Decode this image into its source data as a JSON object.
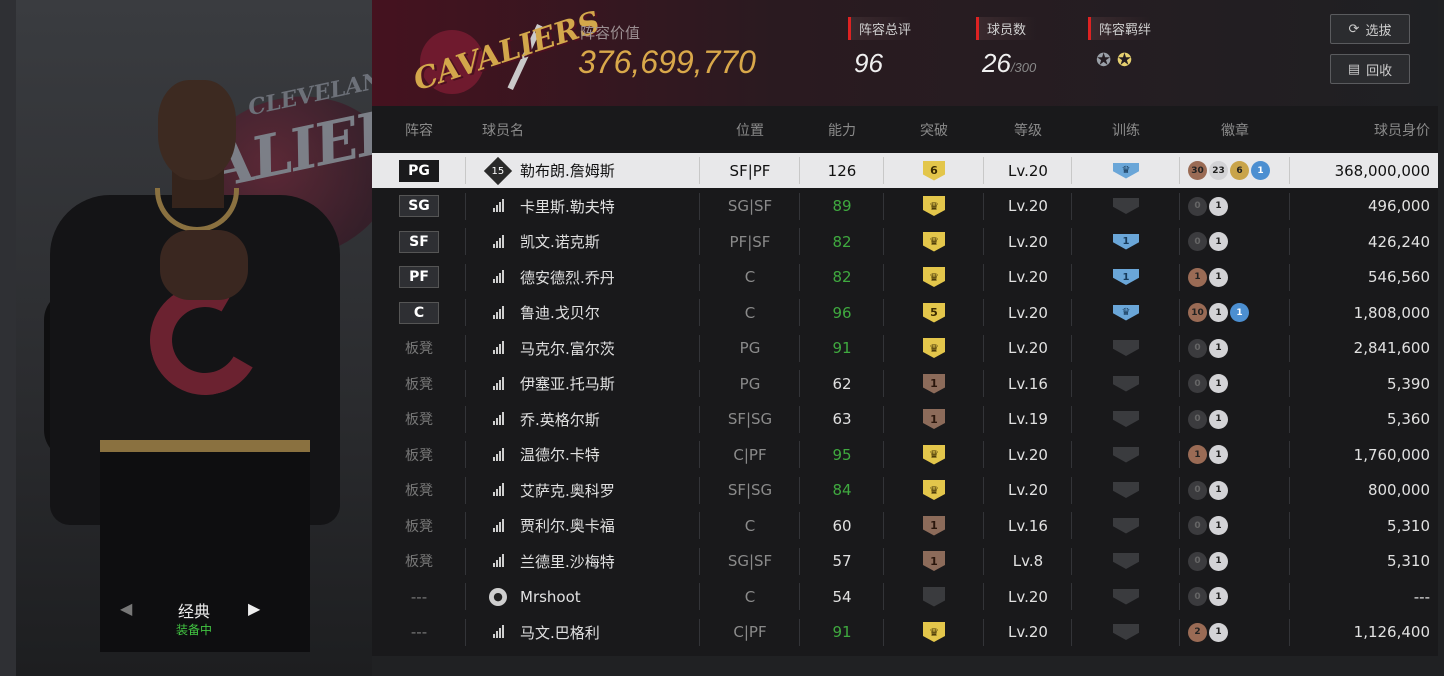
{
  "left": {
    "style_name": "经典",
    "style_status": "装备中"
  },
  "header": {
    "team_logo_text": "CAVALIERS",
    "value_label": "阵容价值",
    "value": "376,699,770",
    "rating_label": "阵容总评",
    "rating": "96",
    "players_label": "球员数",
    "players_count": "26",
    "players_max": "/300",
    "bond_label": "阵容羁绊",
    "select_btn": "选拔",
    "recycle_btn": "回收"
  },
  "columns": [
    "阵容",
    "球员名",
    "位置",
    "能力",
    "突破",
    "等级",
    "训练",
    "徽章",
    "球员身价"
  ],
  "rows": [
    {
      "slot": "PG",
      "slot_type": "pos",
      "icon": "star-15",
      "num": "15",
      "name": "勒布朗.詹姆斯",
      "pos": "SF|PF",
      "ability": "126",
      "ability_color": "white",
      "break": "6",
      "break_type": "gold",
      "level": "Lv.20",
      "train": "blue-crown",
      "badges": [
        [
          "bronze",
          "30"
        ],
        [
          "silver",
          "23"
        ],
        [
          "gold",
          "6"
        ],
        [
          "blue",
          "1"
        ]
      ],
      "price": "368,000,000",
      "selected": true
    },
    {
      "slot": "SG",
      "slot_type": "pos",
      "icon": "signal",
      "name": "卡里斯.勒夫特",
      "pos": "SG|SF",
      "ability": "89",
      "ability_color": "green",
      "break": "♛",
      "break_type": "gold",
      "level": "Lv.20",
      "train": "gray",
      "badges": [
        [
          "dark",
          "0"
        ],
        [
          "silver",
          "1"
        ]
      ],
      "price": "496,000"
    },
    {
      "slot": "SF",
      "slot_type": "pos",
      "icon": "signal",
      "name": "凯文.诺克斯",
      "pos": "PF|SF",
      "ability": "82",
      "ability_color": "green",
      "break": "♛",
      "break_type": "gold",
      "level": "Lv.20",
      "train": "blue-1",
      "badges": [
        [
          "dark",
          "0"
        ],
        [
          "silver",
          "1"
        ]
      ],
      "price": "426,240"
    },
    {
      "slot": "PF",
      "slot_type": "pos",
      "icon": "signal",
      "name": "德安德烈.乔丹",
      "pos": "C",
      "ability": "82",
      "ability_color": "green",
      "break": "♛",
      "break_type": "gold",
      "level": "Lv.20",
      "train": "blue-1",
      "badges": [
        [
          "bronze",
          "1"
        ],
        [
          "silver",
          "1"
        ]
      ],
      "price": "546,560"
    },
    {
      "slot": "C",
      "slot_type": "pos",
      "icon": "signal",
      "name": "鲁迪.戈贝尔",
      "pos": "C",
      "ability": "96",
      "ability_color": "green",
      "break": "5",
      "break_type": "gold",
      "level": "Lv.20",
      "train": "blue-crown",
      "badges": [
        [
          "bronze",
          "10"
        ],
        [
          "silver",
          "1"
        ],
        [
          "blue",
          "1"
        ]
      ],
      "price": "1,808,000"
    },
    {
      "slot": "板凳",
      "slot_type": "bench",
      "icon": "signal",
      "name": "马克尔.富尔茨",
      "pos": "PG",
      "ability": "91",
      "ability_color": "green",
      "break": "♛",
      "break_type": "gold",
      "level": "Lv.20",
      "train": "gray",
      "badges": [
        [
          "dark",
          "0"
        ],
        [
          "silver",
          "1"
        ]
      ],
      "price": "2,841,600"
    },
    {
      "slot": "板凳",
      "slot_type": "bench",
      "icon": "signal",
      "name": "伊塞亚.托马斯",
      "pos": "PG",
      "ability": "62",
      "ability_color": "white",
      "break": "1",
      "break_type": "brown",
      "level": "Lv.16",
      "train": "gray",
      "badges": [
        [
          "dark",
          "0"
        ],
        [
          "silver",
          "1"
        ]
      ],
      "price": "5,390"
    },
    {
      "slot": "板凳",
      "slot_type": "bench",
      "icon": "signal",
      "name": "乔.英格尔斯",
      "pos": "SF|SG",
      "ability": "63",
      "ability_color": "white",
      "break": "1",
      "break_type": "brown",
      "level": "Lv.19",
      "train": "gray",
      "badges": [
        [
          "dark",
          "0"
        ],
        [
          "silver",
          "1"
        ]
      ],
      "price": "5,360"
    },
    {
      "slot": "板凳",
      "slot_type": "bench",
      "icon": "signal",
      "name": "温德尔.卡特",
      "pos": "C|PF",
      "ability": "95",
      "ability_color": "green",
      "break": "♛",
      "break_type": "gold",
      "level": "Lv.20",
      "train": "gray",
      "badges": [
        [
          "bronze",
          "1"
        ],
        [
          "silver",
          "1"
        ]
      ],
      "price": "1,760,000"
    },
    {
      "slot": "板凳",
      "slot_type": "bench",
      "icon": "signal",
      "name": "艾萨克.奥科罗",
      "pos": "SF|SG",
      "ability": "84",
      "ability_color": "green",
      "break": "♛",
      "break_type": "gold",
      "level": "Lv.20",
      "train": "gray",
      "badges": [
        [
          "dark",
          "0"
        ],
        [
          "silver",
          "1"
        ]
      ],
      "price": "800,000"
    },
    {
      "slot": "板凳",
      "slot_type": "bench",
      "icon": "signal",
      "name": "贾利尔.奥卡福",
      "pos": "C",
      "ability": "60",
      "ability_color": "white",
      "break": "1",
      "break_type": "brown",
      "level": "Lv.16",
      "train": "gray",
      "badges": [
        [
          "dark",
          "0"
        ],
        [
          "silver",
          "1"
        ]
      ],
      "price": "5,310"
    },
    {
      "slot": "板凳",
      "slot_type": "bench",
      "icon": "signal",
      "name": "兰德里.沙梅特",
      "pos": "SG|SF",
      "ability": "57",
      "ability_color": "white",
      "break": "1",
      "break_type": "brown",
      "level": "Lv.8",
      "train": "gray",
      "badges": [
        [
          "dark",
          "0"
        ],
        [
          "silver",
          "1"
        ]
      ],
      "price": "5,310"
    },
    {
      "slot": "---",
      "slot_type": "dash",
      "icon": "person",
      "name": "Mrshoot",
      "pos": "C",
      "ability": "54",
      "ability_color": "white",
      "break": "",
      "break_type": "gray",
      "level": "Lv.20",
      "train": "gray",
      "badges": [
        [
          "dark",
          "0"
        ],
        [
          "silver",
          "1"
        ]
      ],
      "price": "---"
    },
    {
      "slot": "---",
      "slot_type": "dash",
      "icon": "signal",
      "name": "马文.巴格利",
      "pos": "C|PF",
      "ability": "91",
      "ability_color": "green",
      "break": "♛",
      "break_type": "gold",
      "level": "Lv.20",
      "train": "gray",
      "badges": [
        [
          "bronze",
          "2"
        ],
        [
          "silver",
          "1"
        ]
      ],
      "price": "1,126,400"
    }
  ]
}
